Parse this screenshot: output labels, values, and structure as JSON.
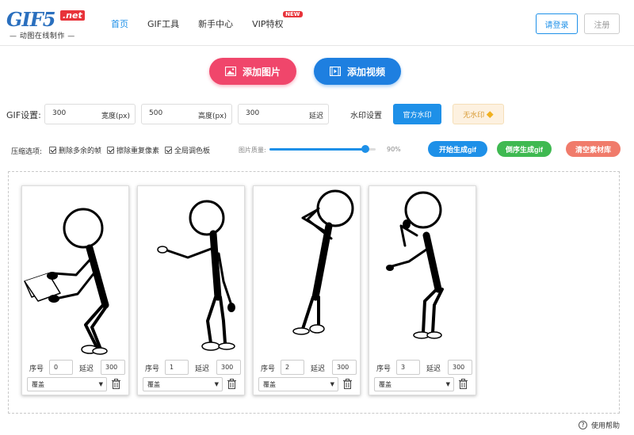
{
  "brand": {
    "logo_main": "GIF5",
    "logo_tld": ".net",
    "logo_subtitle": "动图在线制作"
  },
  "nav": {
    "items": [
      "首页",
      "GIF工具",
      "新手中心",
      "VIP特权"
    ],
    "vip_badge": "NEW"
  },
  "header": {
    "login_label": "请登录",
    "register_label": "注册"
  },
  "actions": {
    "add_image_label": "添加图片",
    "add_video_label": "添加视频"
  },
  "gif_settings": {
    "label": "GIF设置:",
    "width_value": "300",
    "width_unit": "宽度(px)",
    "height_value": "500",
    "height_unit": "高度(px)",
    "delay_value": "300",
    "delay_unit": "延迟",
    "watermark_label": "水印设置",
    "watermark_official": "官方水印",
    "watermark_none": "无水印"
  },
  "compression": {
    "label": "压缩选项:",
    "options": [
      "删除多余的帧",
      "擦除重复像素",
      "全局调色板"
    ],
    "quality_label": "图片质量:",
    "quality_value": "90%",
    "quality_fraction": 0.9
  },
  "generate": {
    "start_label": "开始生成gif",
    "reverse_label": "倒序生成gif",
    "clear_label": "清空素材库"
  },
  "frames": [
    {
      "seq": "0",
      "delay": "300",
      "mode": "覆盖"
    },
    {
      "seq": "1",
      "delay": "300",
      "mode": "覆盖"
    },
    {
      "seq": "2",
      "delay": "300",
      "mode": "覆盖"
    },
    {
      "seq": "3",
      "delay": "300",
      "mode": "覆盖"
    }
  ],
  "frame_labels": {
    "seq_label": "序号",
    "delay_label": "延迟"
  },
  "help_label": "使用帮助",
  "colors": {
    "primary": "#1e90e8",
    "pink": "#f0466b",
    "green": "#3fb951",
    "salmon": "#f07b6b",
    "brand_red": "#e8333a"
  }
}
